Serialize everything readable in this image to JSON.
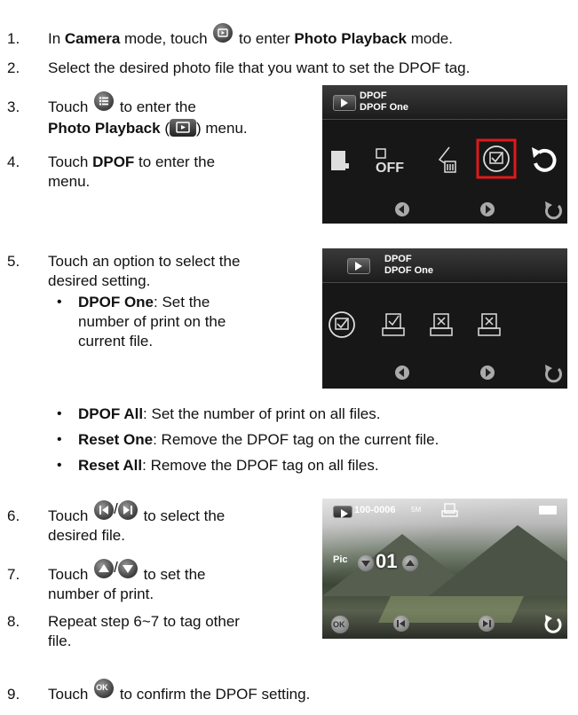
{
  "steps": {
    "s1": {
      "num": "1.",
      "a": "In ",
      "b1": "Camera",
      "c": " mode, touch ",
      "d": " to enter ",
      "b2": "Photo Playback",
      "e": " mode."
    },
    "s2": {
      "num": "2.",
      "text": "Select the desired photo file that you want to set the DPOF tag."
    },
    "s3": {
      "num": "3.",
      "a": "Touch ",
      "b": " to enter the",
      "b1": "Photo Playback",
      "c": " (",
      "d": ") menu."
    },
    "s4": {
      "num": "4.",
      "a": "Touch ",
      "b1": "DPOF",
      "c": " to enter the",
      "d": "menu."
    },
    "s5": {
      "num": "5.",
      "line1": "Touch an option to select the",
      "line2": "desired setting."
    },
    "bullets": [
      {
        "bold": "DPOF One",
        "rest1": ": Set the",
        "rest2": "number of print on the",
        "rest3": "current file."
      },
      {
        "bold": "DPOF All",
        "rest": ": Set the number of print on all files."
      },
      {
        "bold": "Reset One",
        "rest": ": Remove the DPOF tag on the current file."
      },
      {
        "bold": "Reset All",
        "rest": ": Remove the DPOF tag on all files."
      }
    ],
    "s6": {
      "num": "6.",
      "a": "Touch ",
      "b": " to select the",
      "c": "desired file."
    },
    "s7": {
      "num": "7.",
      "a": "Touch ",
      "b": " to set the",
      "c": "number of print."
    },
    "s8": {
      "num": "8.",
      "line1": "Repeat step 6~7 to tag other",
      "line2": "file."
    },
    "s9": {
      "num": "9.",
      "a": "Touch ",
      "b": " to confirm the DPOF setting."
    }
  },
  "screen1": {
    "title1": "DPOF",
    "title2": "DPOF One",
    "icons": [
      "dpof-file-key-icon",
      "dpof-off-icon",
      "delete-icon",
      "dpof-print-icon",
      "return-icon"
    ]
  },
  "screen2": {
    "title1": "DPOF",
    "title2": "DPOF One",
    "icons": [
      "dpof-one-icon",
      "dpof-all-icon",
      "reset-one-icon",
      "reset-all-icon"
    ]
  },
  "screen3": {
    "file": "100-0006",
    "size": "5M",
    "label": "Pic",
    "count": "01",
    "ok": "OK"
  }
}
